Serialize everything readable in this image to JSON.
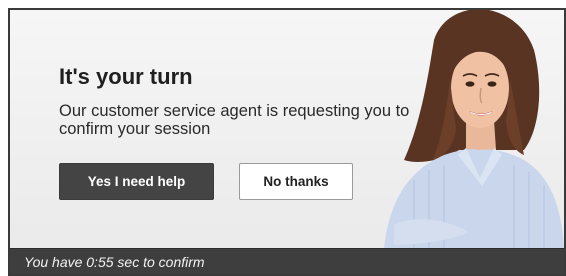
{
  "dialog": {
    "title": "It's your turn",
    "message": "Our customer service agent is requesting you to confirm your session",
    "buttons": {
      "primary_label": "Yes I need help",
      "secondary_label": "No thanks"
    },
    "footer_text": "You have 0:55 sec to confirm"
  },
  "colors": {
    "primary_button_bg": "#444444",
    "footer_bg": "#3e3e3e",
    "dialog_bg": "#eeeeee",
    "border": "#3a3a3a"
  },
  "icons": {
    "agent": "customer-service-agent-photo"
  }
}
